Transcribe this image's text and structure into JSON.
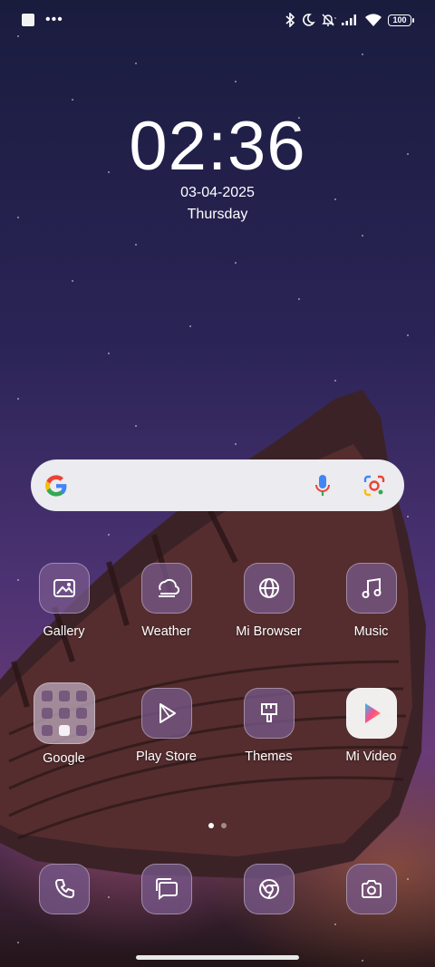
{
  "statusbar": {
    "battery": "100"
  },
  "clock": {
    "time": "02:36",
    "date": "03-04-2025",
    "day": "Thursday"
  },
  "search": {
    "icons": [
      "google-logo",
      "mic-icon",
      "lens-icon"
    ]
  },
  "apps_row1": [
    {
      "label": "Gallery",
      "icon": "gallery-icon"
    },
    {
      "label": "Weather",
      "icon": "weather-icon"
    },
    {
      "label": "Mi Browser",
      "icon": "globe-icon"
    },
    {
      "label": "Music",
      "icon": "music-icon"
    }
  ],
  "apps_row2": [
    {
      "label": "Google",
      "icon": "folder-icon"
    },
    {
      "label": "Play Store",
      "icon": "play-store-icon"
    },
    {
      "label": "Themes",
      "icon": "themes-icon"
    },
    {
      "label": "Mi Video",
      "icon": "mi-video-icon"
    }
  ],
  "dock": [
    {
      "icon": "phone-icon"
    },
    {
      "icon": "messages-icon"
    },
    {
      "icon": "chrome-icon"
    },
    {
      "icon": "camera-icon"
    }
  ],
  "page_indicator": {
    "pages": 2,
    "active": 1
  }
}
